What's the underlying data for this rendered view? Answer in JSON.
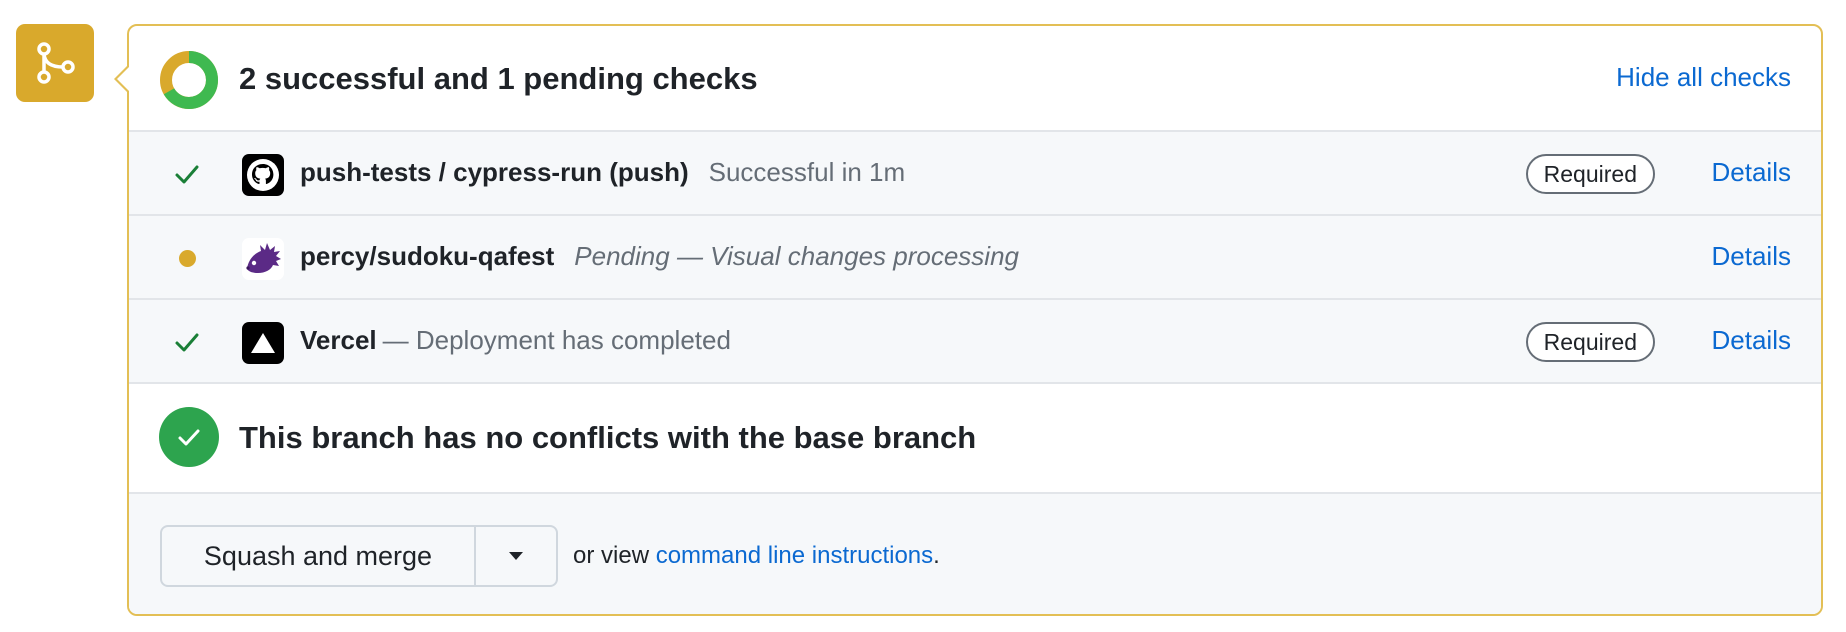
{
  "colors": {
    "accent_yellow": "#d9a92c",
    "success_green": "#2da44e",
    "link_blue": "#0b69d1",
    "pending_yellow": "#d9a92c"
  },
  "merge_icon": "git-merge-icon",
  "summary": {
    "title": "2 successful and 1 pending checks",
    "hide_label": "Hide all checks",
    "successful_count": 2,
    "pending_count": 1
  },
  "checks": [
    {
      "status": "success",
      "app_icon": "github-icon",
      "name": "push-tests / cypress-run (push)",
      "description": "Successful in 1m",
      "required_label": "Required",
      "details_label": "Details"
    },
    {
      "status": "pending",
      "app_icon": "percy-hedgehog-icon",
      "name": "percy/sudoku-qafest",
      "description": "Pending — Visual changes processing",
      "details_label": "Details"
    },
    {
      "status": "success",
      "app_icon": "vercel-icon",
      "name": "Vercel",
      "description": "— Deployment has completed",
      "required_label": "Required",
      "details_label": "Details"
    }
  ],
  "conflicts": {
    "title": "This branch has no conflicts with the base branch"
  },
  "merge": {
    "button_label": "Squash and merge",
    "dropdown_icon": "caret-down-icon",
    "or_view_text": "or view ",
    "cmd_link": "command line instructions",
    "period": "."
  }
}
